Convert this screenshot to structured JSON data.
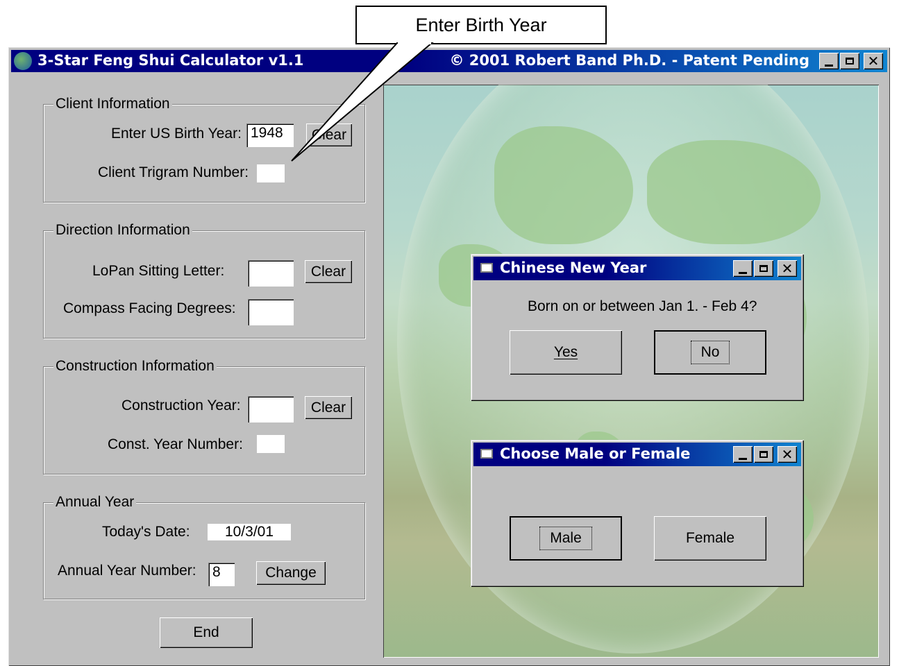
{
  "window": {
    "title_left": "3-Star Feng Shui Calculator  v1.1",
    "title_right": "© 2001 Robert Band Ph.D. -  Patent Pending",
    "app_icon": "globe-icon",
    "controls": [
      "minimize-icon",
      "maximize-icon",
      "close-icon"
    ]
  },
  "callout": {
    "text": "Enter Birth Year"
  },
  "client": {
    "legend": "Client Information",
    "birth_year_label": "Enter US Birth Year:",
    "birth_year_value": "1948",
    "clear_label": "Clear",
    "trigram_label": "Client Trigram Number:",
    "trigram_value": ""
  },
  "direction": {
    "legend": "Direction Information",
    "sitting_label": "LoPan Sitting Letter:",
    "sitting_value": "",
    "clear_label": "Clear",
    "facing_label": "Compass Facing Degrees:",
    "facing_value": ""
  },
  "construction": {
    "legend": "Construction Information",
    "year_label": "Construction Year:",
    "year_value": "",
    "clear_label": "Clear",
    "number_label": "Const. Year Number:",
    "number_value": ""
  },
  "annual": {
    "legend": "Annual Year",
    "date_label": "Today's Date:",
    "date_value": "10/3/01",
    "number_label": "Annual Year Number:",
    "number_value": "8",
    "change_label": "Change"
  },
  "end_label": "End",
  "dialog_new_year": {
    "title": "Chinese New Year",
    "question": "Born on or between Jan 1. - Feb 4?",
    "yes_label": "Yes",
    "no_label": "No"
  },
  "dialog_gender": {
    "title": "Choose Male or Female",
    "male_label": "Male",
    "female_label": "Female"
  },
  "colors": {
    "title_active": "#000080",
    "title_gradient_end": "#1084d0",
    "face": "#c0c0c0"
  }
}
